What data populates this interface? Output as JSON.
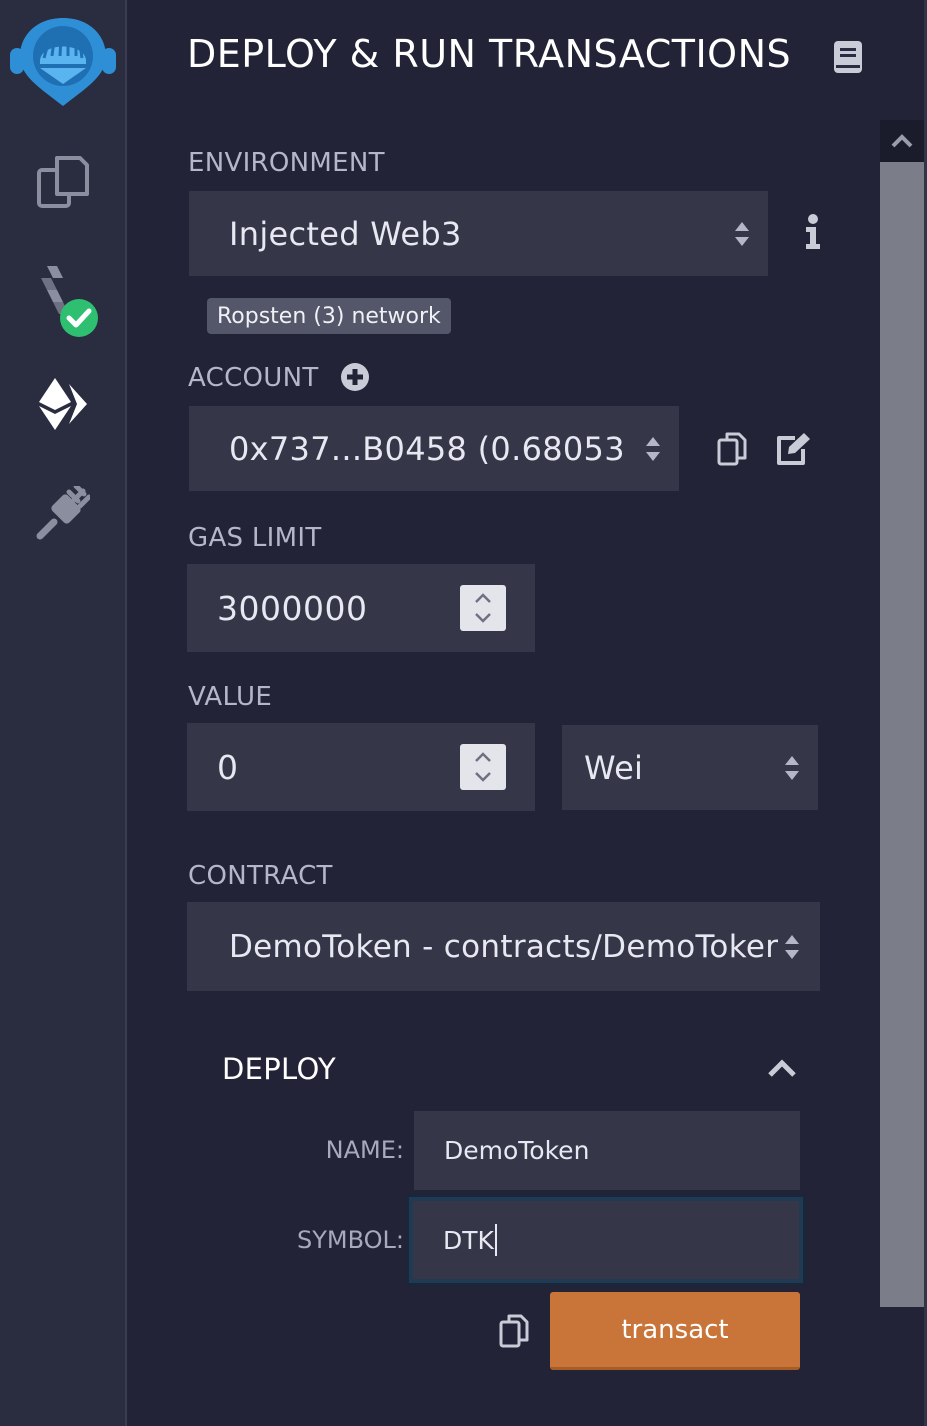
{
  "sidebar": {
    "items": [
      {
        "name": "remix-logo-icon"
      },
      {
        "name": "file-explorer-icon"
      },
      {
        "name": "solidity-compiler-icon",
        "status": "success"
      },
      {
        "name": "deploy-run-icon",
        "active": true
      },
      {
        "name": "plugin-manager-icon"
      }
    ]
  },
  "header": {
    "title": "DEPLOY & RUN TRANSACTIONS"
  },
  "environment": {
    "label": "ENVIRONMENT",
    "value": "Injected Web3",
    "network_badge": "Ropsten (3) network"
  },
  "account": {
    "label": "ACCOUNT",
    "value": "0x737...B0458 (0.68053"
  },
  "gas_limit": {
    "label": "GAS LIMIT",
    "value": "3000000"
  },
  "value": {
    "label": "VALUE",
    "amount": "0",
    "unit": "Wei"
  },
  "contract": {
    "label": "CONTRACT",
    "value": "DemoToken - contracts/DemoToker"
  },
  "deploy": {
    "title": "DEPLOY",
    "fields": [
      {
        "label": "NAME:",
        "value": "DemoToken"
      },
      {
        "label": "SYMBOL:",
        "value": "DTK"
      }
    ],
    "transact_label": "transact"
  },
  "colors": {
    "background": "#222336",
    "sidebar": "#2a2c3f",
    "input": "#353749",
    "accent_orange": "#c97539",
    "success_green": "#2fbf71",
    "logo_blue": "#2f8fd6"
  }
}
